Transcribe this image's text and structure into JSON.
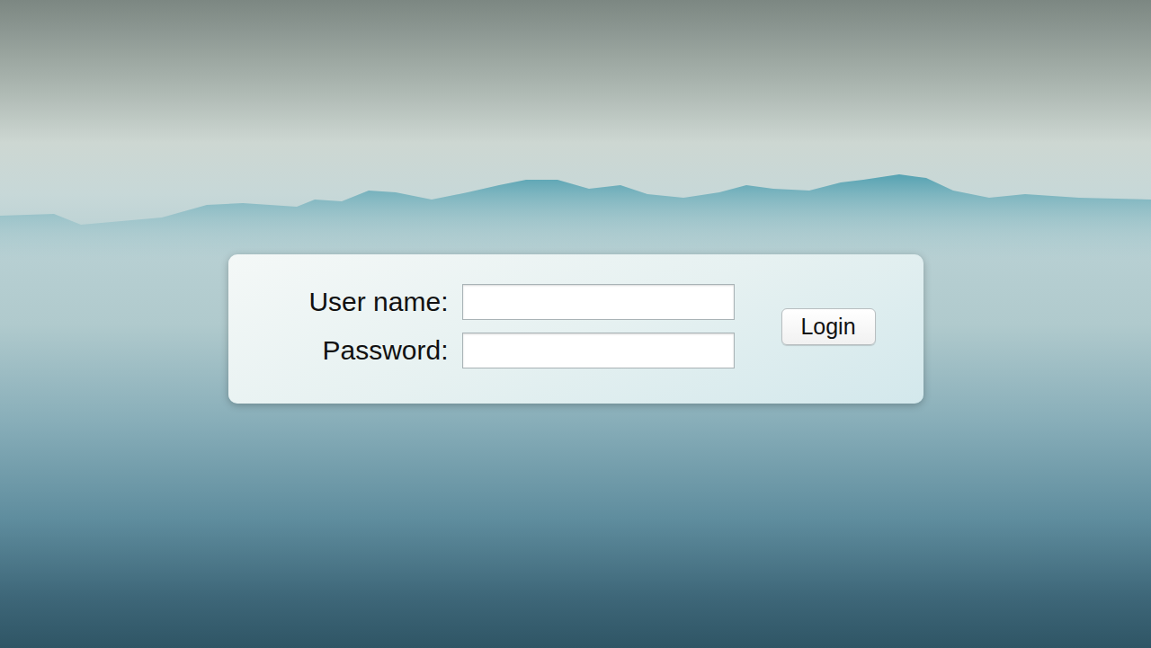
{
  "form": {
    "fields": [
      {
        "label": "User name:",
        "value": ""
      },
      {
        "label": "Password:",
        "value": ""
      }
    ],
    "button": "Login"
  }
}
